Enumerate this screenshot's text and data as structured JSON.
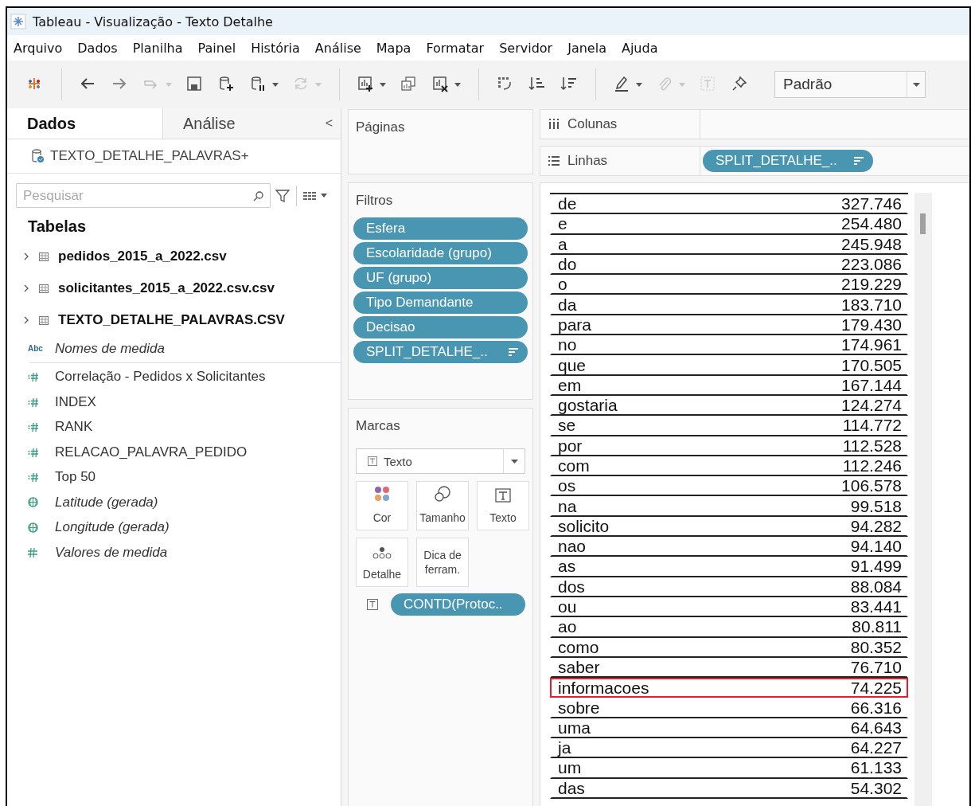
{
  "window": {
    "title": "Tableau - Visualização - Texto Detalhe"
  },
  "menu": [
    {
      "label": "Arquivo"
    },
    {
      "label": "Dados"
    },
    {
      "label": "Planilha"
    },
    {
      "label": "Painel"
    },
    {
      "label": "História"
    },
    {
      "label": "Análise"
    },
    {
      "label": "Mapa"
    },
    {
      "label": "Formatar"
    },
    {
      "label": "Servidor"
    },
    {
      "label": "Janela"
    },
    {
      "label": "Ajuda"
    }
  ],
  "toolbar": [
    {
      "kind": "logo"
    },
    {
      "kind": "separator"
    },
    {
      "kind": "back",
      "disabled": false,
      "dropdown": false
    },
    {
      "kind": "forward",
      "disabled": false,
      "dropdown": false
    },
    {
      "kind": "redo",
      "disabled": true,
      "dropdown": true
    },
    {
      "kind": "save",
      "disabled": false,
      "dropdown": false
    },
    {
      "kind": "add-data",
      "disabled": false,
      "dropdown": false
    },
    {
      "kind": "pause-data",
      "disabled": false,
      "dropdown": true
    },
    {
      "kind": "refresh",
      "disabled": true,
      "dropdown": true
    },
    {
      "kind": "separator"
    },
    {
      "kind": "new-sheet",
      "disabled": false,
      "dropdown": true
    },
    {
      "kind": "duplicate",
      "disabled": false,
      "dropdown": false
    },
    {
      "kind": "clear",
      "disabled": false,
      "dropdown": true
    },
    {
      "kind": "separator"
    },
    {
      "kind": "swap",
      "disabled": false,
      "dropdown": false
    },
    {
      "kind": "sort-asc",
      "disabled": false,
      "dropdown": false
    },
    {
      "kind": "sort-desc",
      "disabled": false,
      "dropdown": false
    },
    {
      "kind": "separator"
    },
    {
      "kind": "highlight",
      "disabled": false,
      "dropdown": true
    },
    {
      "kind": "attach",
      "disabled": true,
      "dropdown": true
    },
    {
      "kind": "label",
      "disabled": true,
      "dropdown": false
    },
    {
      "kind": "pin",
      "disabled": false,
      "dropdown": false
    }
  ],
  "fit_dropdown": {
    "value": "Padrão"
  },
  "data_pane": {
    "tabs": [
      {
        "label": "Dados",
        "selected": true
      },
      {
        "label": "Análise",
        "selected": false
      }
    ],
    "collapse": "<",
    "datasource": "TEXTO_DETALHE_PALAVRAS+",
    "search": {
      "placeholder": "Pesquisar"
    },
    "tables_heading": "Tabelas",
    "tables": [
      {
        "name": "pedidos_2015_a_2022.csv",
        "expanded": false
      },
      {
        "name": "solicitantes_2015_a_2022.csv.csv",
        "expanded": false
      },
      {
        "name": "TEXTO_DETALHE_PALAVRAS.CSV",
        "expanded": false
      }
    ],
    "names_field": {
      "name": "Nomes de medida",
      "kind": "names",
      "type_label": "Abc",
      "generated": true
    },
    "measures": [
      {
        "name": "Correlação - Pedidos x Solicitantes",
        "kind": "calc",
        "generated": false
      },
      {
        "name": "INDEX",
        "kind": "calc",
        "generated": false
      },
      {
        "name": "RANK",
        "kind": "calc",
        "generated": false
      },
      {
        "name": "RELACAO_PALAVRA_PEDIDO",
        "kind": "calc",
        "generated": false
      },
      {
        "name": "Top 50",
        "kind": "calc",
        "generated": false
      },
      {
        "name": "Latitude (gerada)",
        "kind": "geo",
        "generated": true
      },
      {
        "name": "Longitude (gerada)",
        "kind": "geo",
        "generated": true
      },
      {
        "name": "Valores de medida",
        "kind": "measure",
        "generated": true
      }
    ]
  },
  "pages": {
    "title": "Páginas"
  },
  "filters": {
    "title": "Filtros",
    "pills": [
      {
        "label": "Esfera",
        "sorted": false
      },
      {
        "label": "Escolaridade (grupo)",
        "sorted": false
      },
      {
        "label": "UF (grupo)",
        "sorted": false
      },
      {
        "label": "Tipo Demandante",
        "sorted": false
      },
      {
        "label": "Decisao",
        "sorted": false
      },
      {
        "label": "SPLIT_DETALHE_..",
        "sorted": true
      }
    ]
  },
  "marks": {
    "title": "Marcas",
    "mark_type": "Texto",
    "cards": [
      {
        "kind": "color",
        "label": "Cor"
      },
      {
        "kind": "size",
        "label": "Tamanho"
      },
      {
        "kind": "text",
        "label": "Texto"
      },
      {
        "kind": "detail",
        "label": "Detalhe"
      },
      {
        "kind": "tooltip",
        "label": "Dica de ferram."
      }
    ],
    "fields": [
      {
        "kind": "text",
        "label": "CONTD(Protoc.."
      }
    ]
  },
  "columns_shelf": {
    "label": "Colunas"
  },
  "rows_shelf": {
    "label": "Linhas",
    "pills": [
      {
        "label": "SPLIT_DETALHE_..",
        "sorted": true
      }
    ]
  },
  "table": {
    "rows": [
      {
        "word": "de",
        "count": "327.746",
        "highlighted": false
      },
      {
        "word": "e",
        "count": "254.480",
        "highlighted": false
      },
      {
        "word": "a",
        "count": "245.948",
        "highlighted": false
      },
      {
        "word": "do",
        "count": "223.086",
        "highlighted": false
      },
      {
        "word": "o",
        "count": "219.229",
        "highlighted": false
      },
      {
        "word": "da",
        "count": "183.710",
        "highlighted": false
      },
      {
        "word": "para",
        "count": "179.430",
        "highlighted": false
      },
      {
        "word": "no",
        "count": "174.961",
        "highlighted": false
      },
      {
        "word": "que",
        "count": "170.505",
        "highlighted": false
      },
      {
        "word": "em",
        "count": "167.144",
        "highlighted": false
      },
      {
        "word": "gostaria",
        "count": "124.274",
        "highlighted": false
      },
      {
        "word": "se",
        "count": "114.772",
        "highlighted": false
      },
      {
        "word": "por",
        "count": "112.528",
        "highlighted": false
      },
      {
        "word": "com",
        "count": "112.246",
        "highlighted": false
      },
      {
        "word": "os",
        "count": "106.578",
        "highlighted": false
      },
      {
        "word": "na",
        "count": "99.518",
        "highlighted": false
      },
      {
        "word": "solicito",
        "count": "94.282",
        "highlighted": false
      },
      {
        "word": "nao",
        "count": "94.140",
        "highlighted": false
      },
      {
        "word": "as",
        "count": "91.499",
        "highlighted": false
      },
      {
        "word": "dos",
        "count": "88.084",
        "highlighted": false
      },
      {
        "word": "ou",
        "count": "83.441",
        "highlighted": false
      },
      {
        "word": "ao",
        "count": "80.811",
        "highlighted": false
      },
      {
        "word": "como",
        "count": "80.352",
        "highlighted": false
      },
      {
        "word": "saber",
        "count": "76.710",
        "highlighted": false
      },
      {
        "word": "informacoes",
        "count": "74.225",
        "highlighted": true
      },
      {
        "word": "sobre",
        "count": "66.316",
        "highlighted": false
      },
      {
        "word": "uma",
        "count": "64.643",
        "highlighted": false
      },
      {
        "word": "ja",
        "count": "64.227",
        "highlighted": false
      },
      {
        "word": "um",
        "count": "61.133",
        "highlighted": false
      },
      {
        "word": "das",
        "count": "54.302",
        "highlighted": false
      }
    ]
  }
}
